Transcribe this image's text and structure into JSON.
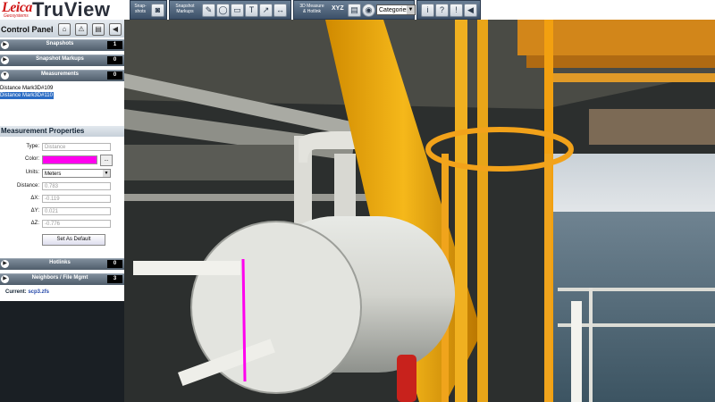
{
  "brand": {
    "leica": "Leica",
    "sub": "Geosystems",
    "product": "TruView"
  },
  "toolbar": {
    "snapshot_label": "Snap-\nshots",
    "markups_label": "Snapshot\nMarkups",
    "measure_label": "3D Measure\n& Hotlink",
    "xyz_label": "XYZ",
    "category_value": "Categories"
  },
  "panel": {
    "title": "Control Panel",
    "sections": {
      "snapshots": {
        "label": "Snapshots",
        "count": "1"
      },
      "markups": {
        "label": "Snapshot Markups",
        "count": "0"
      },
      "measurements": {
        "label": "Measurements",
        "count": "0"
      },
      "hotlinks": {
        "label": "Hotlinks",
        "count": "0"
      },
      "neighbors": {
        "label": "Neighbors / File Mgmt",
        "count": "3"
      }
    },
    "measurements": [
      {
        "label": "Distance Mark3D#109",
        "selected": false
      },
      {
        "label": "Distance Mark3D#110",
        "selected": true
      }
    ],
    "properties": {
      "title": "Measurement Properties",
      "type_label": "Type:",
      "type_value": "Distance",
      "color_label": "Color:",
      "color_value": "#ff00ee",
      "units_label": "Units:",
      "units_value": "Meters",
      "distance_label": "Distance:",
      "distance_value": "0.783",
      "dx_label": "ΔX:",
      "dx_value": "-0.119",
      "dy_label": "ΔY:",
      "dy_value": "0.021",
      "dz_label": "ΔZ:",
      "dz_value": "-0.776",
      "default_button": "Set As Default",
      "browse_button": "..."
    },
    "current_label": "Current:",
    "current_value": "scp3.zfs"
  },
  "colors": {
    "accent": "#3c5068",
    "measure_line": "#ff00ee"
  }
}
